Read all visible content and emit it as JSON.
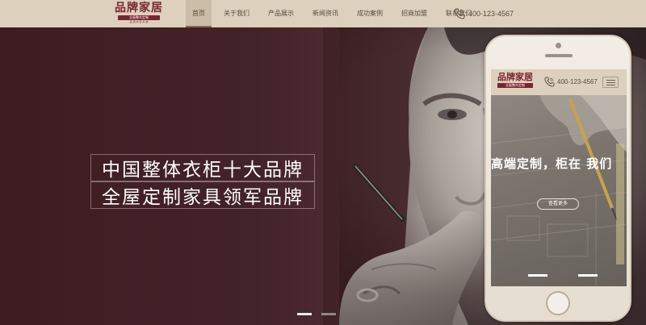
{
  "header": {
    "logo": {
      "main": "品牌家居",
      "sub": "全屋整木定制",
      "tiny": "品 质 成 就 卓 越"
    },
    "nav": [
      {
        "label": "首页",
        "active": true
      },
      {
        "label": "关于我们",
        "active": false
      },
      {
        "label": "产品展示",
        "active": false
      },
      {
        "label": "新闻资讯",
        "active": false
      },
      {
        "label": "成功案例",
        "active": false
      },
      {
        "label": "招商加盟",
        "active": false
      },
      {
        "label": "联系我们",
        "active": false
      }
    ],
    "phone": "400-123-4567",
    "phone_icon": "phone-icon"
  },
  "hero": {
    "slogan_line1": "中国整体衣柜十大品牌",
    "slogan_line2": "全屋定制家具领军品牌",
    "slides": 2,
    "active_slide": 1
  },
  "mobile": {
    "logo": {
      "main": "品牌家居",
      "sub": "全屋整木定制"
    },
    "phone": "400-123-4567",
    "menu_icon": "hamburger-menu-icon",
    "banner_slogan": "高端定制，柜在 我们",
    "more_button": "查看更多",
    "slides": 2
  },
  "colors": {
    "header_bg": "#ddd0bc",
    "brand": "#7a2530",
    "hero_dark": "#3d1c21"
  }
}
